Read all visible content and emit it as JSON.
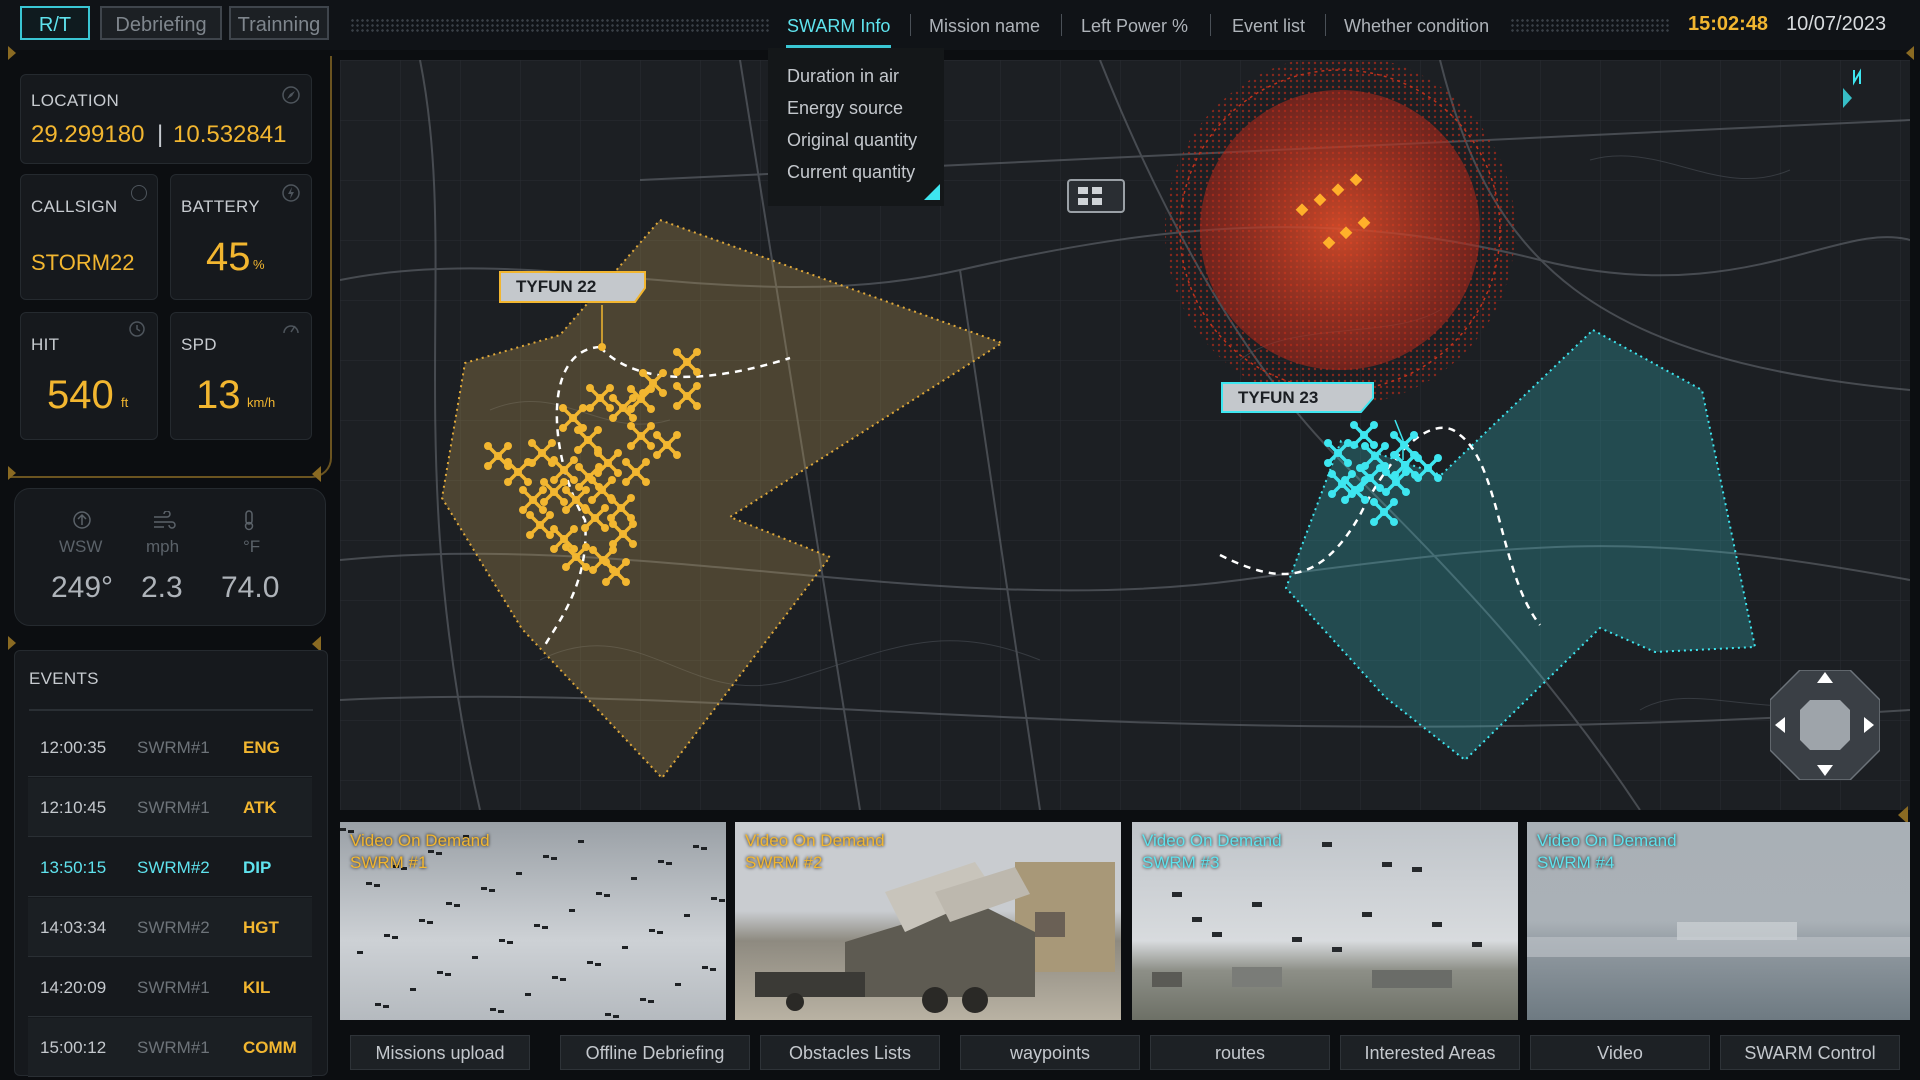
{
  "modes": [
    "R/T",
    "Debriefing",
    "Trainning"
  ],
  "nav_tabs": [
    "SWARM Info",
    "Mission name",
    "Left Power %",
    "Event list",
    "Whether condition"
  ],
  "clock": "15:02:48",
  "date": "10/07/2023",
  "swarm_info_menu": [
    "Duration in air",
    "Energy source",
    "Original quantity",
    "Current quantity"
  ],
  "location": {
    "label": "LOCATION",
    "lat": "29.299180",
    "sep": "|",
    "lon": "10.532841"
  },
  "callsign": {
    "label": "CALLSIGN",
    "value": "STORM22"
  },
  "battery": {
    "label": "BATTERY",
    "value": "45",
    "unit": "%"
  },
  "hit": {
    "label": "HIT",
    "value": "540",
    "unit": "ft"
  },
  "spd": {
    "label": "SPD",
    "value": "13",
    "unit": "km/h"
  },
  "weather": {
    "dir_label": "WSW",
    "dir_value": "249°",
    "wind_label": "mph",
    "wind_value": "2.3",
    "temp_label": "°F",
    "temp_value": "74.0"
  },
  "events": {
    "label": "EVENTS",
    "rows": [
      {
        "time": "12:00:35",
        "swarm": "SWRM#1",
        "code": "ENG"
      },
      {
        "time": "12:10:45",
        "swarm": "SWRM#1",
        "code": "ATK"
      },
      {
        "time": "13:50:15",
        "swarm": "SWRM#2",
        "code": "DIP"
      },
      {
        "time": "14:03:34",
        "swarm": "SWRM#2",
        "code": "HGT"
      },
      {
        "time": "14:20:09",
        "swarm": "SWRM#1",
        "code": "KIL"
      },
      {
        "time": "15:00:12",
        "swarm": "SWRM#1",
        "code": "COMM"
      }
    ],
    "selected_index": 2
  },
  "map": {
    "label_tyfun22": "TYFUN 22",
    "label_tyfun23": "TYFUN 23",
    "colors": {
      "orange": "#f2b630",
      "cyan": "#3ee6f0",
      "red": "#e83a1e"
    }
  },
  "videos": [
    {
      "line1": "Video On Demand",
      "line2": "SWRM #1"
    },
    {
      "line1": "Video On Demand",
      "line2": "SWRM #2"
    },
    {
      "line1": "Video On Demand",
      "line2": "SWRM #3"
    },
    {
      "line1": "Video On Demand",
      "line2": "SWRM #4"
    }
  ],
  "bottom_buttons": [
    "Missions upload",
    "Offline Debriefing",
    "Obstacles Lists",
    "waypoints",
    "routes",
    "Interested Areas",
    "Video",
    "SWARM Control"
  ],
  "colors": {
    "accent_cyan": "#5fe3ee",
    "accent_orange": "#f2b630",
    "bg": "#0c0e11"
  }
}
